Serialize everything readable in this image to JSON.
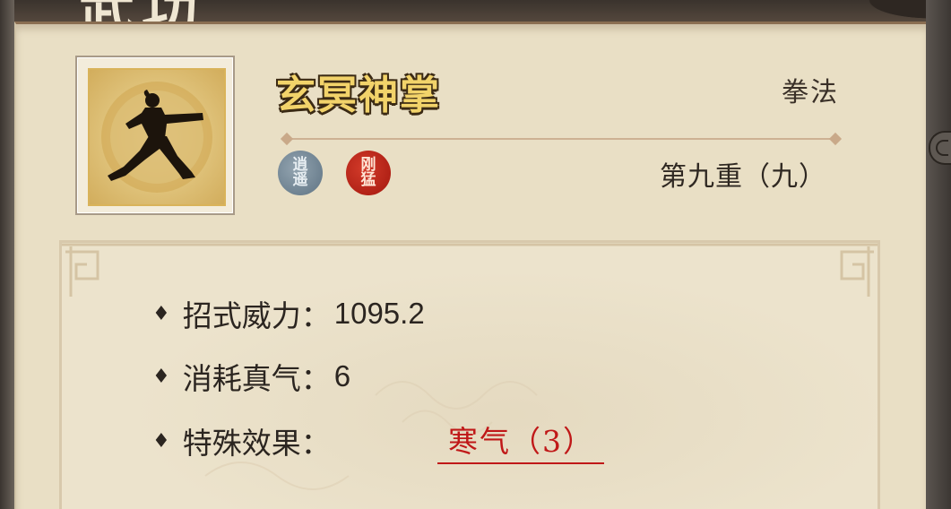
{
  "header": {
    "title_partial": "武功"
  },
  "skill": {
    "name": "玄冥神掌",
    "type": "拳法",
    "level": "第九重（九）",
    "icon": "martial-artist-stance-icon",
    "tags": [
      {
        "text": "逍遥",
        "color": "#6f8394"
      },
      {
        "text": "刚猛",
        "color": "#b8231a"
      }
    ]
  },
  "stats": {
    "power_label": "招式威力：",
    "power_value": "1095.2",
    "cost_label": "消耗真气：",
    "cost_value": "6",
    "effect_label": "特殊效果：",
    "effect_value": "寒气（3）"
  },
  "colors": {
    "parchment": "#e9dfc5",
    "name_gold": "#f2d36a",
    "effect_red": "#c01818"
  }
}
